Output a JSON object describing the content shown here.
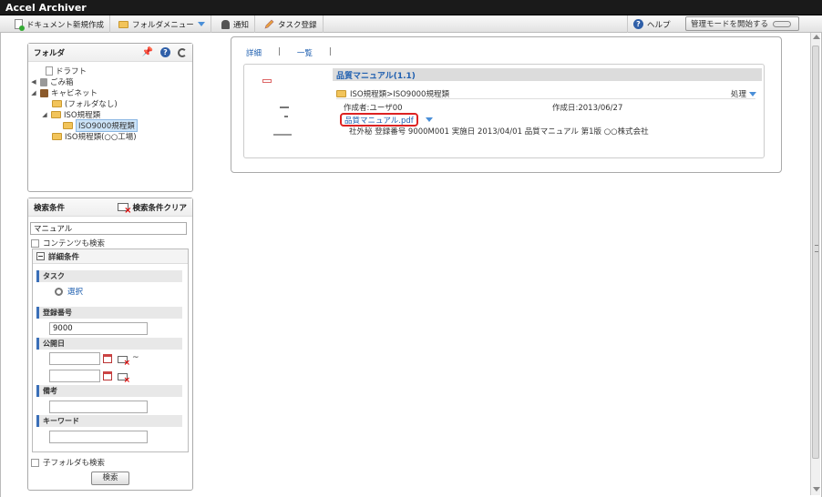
{
  "app": {
    "title": "Accel Archiver"
  },
  "toolbar": {
    "new_document": "ドキュメント新規作成",
    "folder_menu": "フォルダメニュー",
    "notification": "通知",
    "task_register": "タスク登録",
    "help": "ヘルプ",
    "admin_mode": "管理モードを開始する"
  },
  "folder_panel": {
    "title": "フォルダ",
    "tree": [
      {
        "label": "ドラフト"
      },
      {
        "label": "ごみ箱"
      },
      {
        "label": "キャビネット"
      },
      {
        "label": "(フォルダなし)"
      },
      {
        "label": "ISO規程類"
      },
      {
        "label": "ISO9000規程類"
      },
      {
        "label": "ISO規程類(○○工場)"
      }
    ]
  },
  "search_panel": {
    "title": "検索条件",
    "clear_label": "検索条件クリア",
    "keyword_value": "マニュアル",
    "content_search_label": "コンテンツも検索",
    "details": {
      "title": "詳細条件",
      "task_label": "タスク",
      "task_select": "選択",
      "reg_no_label": "登録番号",
      "reg_no_value": "9000",
      "pub_date_label": "公開日",
      "tilde": "~",
      "remarks_label": "備考",
      "keyword_label": "キーワード"
    },
    "subfolder_label": "子フォルダも検索",
    "search_button": "検索"
  },
  "main": {
    "tabs": [
      {
        "label": "詳細"
      },
      {
        "label": "一覧"
      }
    ],
    "tab_sep": "|",
    "result": {
      "title": "品質マニュアル(1.1)",
      "path": "ISO規程類>ISO9000規程類",
      "action": "処理",
      "creator": "作成者:ユーザ00",
      "created": "作成日:2013/06/27",
      "file": "品質マニュアル.pdf",
      "desc": "社外秘 登録番号 9000M001 実施日 2013/04/01 品質マニュアル 第1版 ○○株式会社"
    }
  },
  "colors": {
    "titlebar": "#1a1a1a",
    "link": "#2060b0",
    "highlight": "#d22222"
  }
}
